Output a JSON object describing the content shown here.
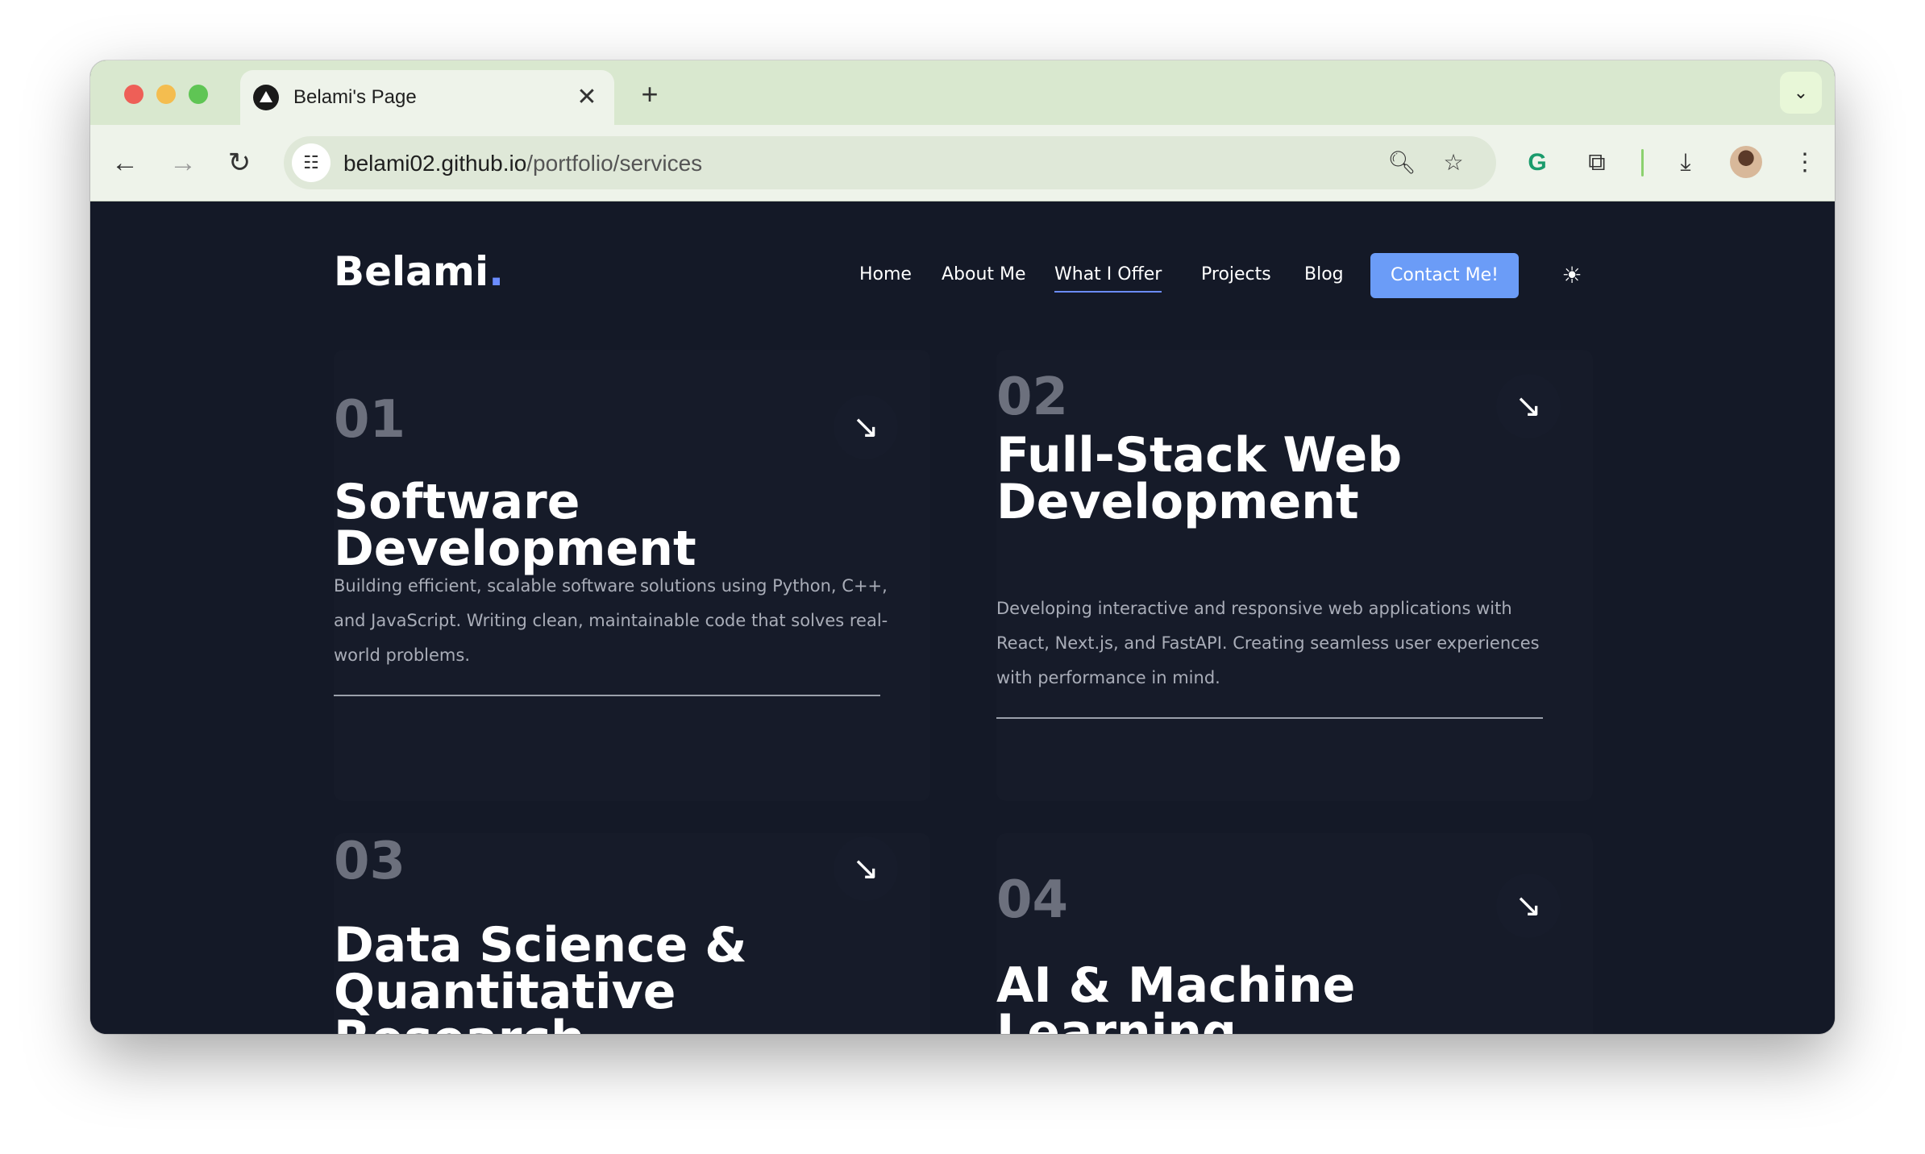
{
  "browser": {
    "tab_title": "Belami's Page",
    "tab_close": "✕",
    "new_tab": "+",
    "tab_search_icon": "⌄",
    "url_host": "belami02.github.io",
    "url_path": "/portfolio/services"
  },
  "header": {
    "logo_text": "Belami",
    "logo_dot": ".",
    "nav": [
      "Home",
      "About Me",
      "What I Offer",
      "Projects",
      "Blog"
    ],
    "active_nav": "What I Offer",
    "contact_label": "Contact Me!",
    "theme_icon": "☀"
  },
  "services": [
    {
      "number": "01",
      "title": "Software Development",
      "description": "Building efficient, scalable software solutions using Python, C++, and JavaScript. Writing clean, maintainable code that solves real-world problems."
    },
    {
      "number": "02",
      "title": "Full-Stack Web Development",
      "description": "Developing interactive and responsive web applications with React, Next.js, and FastAPI. Creating seamless user experiences with performance in mind."
    },
    {
      "number": "03",
      "title": "Data Science & Quantitative Research"
    },
    {
      "number": "04",
      "title": "AI & Machine Learning"
    }
  ],
  "colors": {
    "page_background": "#141927",
    "accent": "#6b9cf7",
    "number_gray": "#6c707d"
  }
}
